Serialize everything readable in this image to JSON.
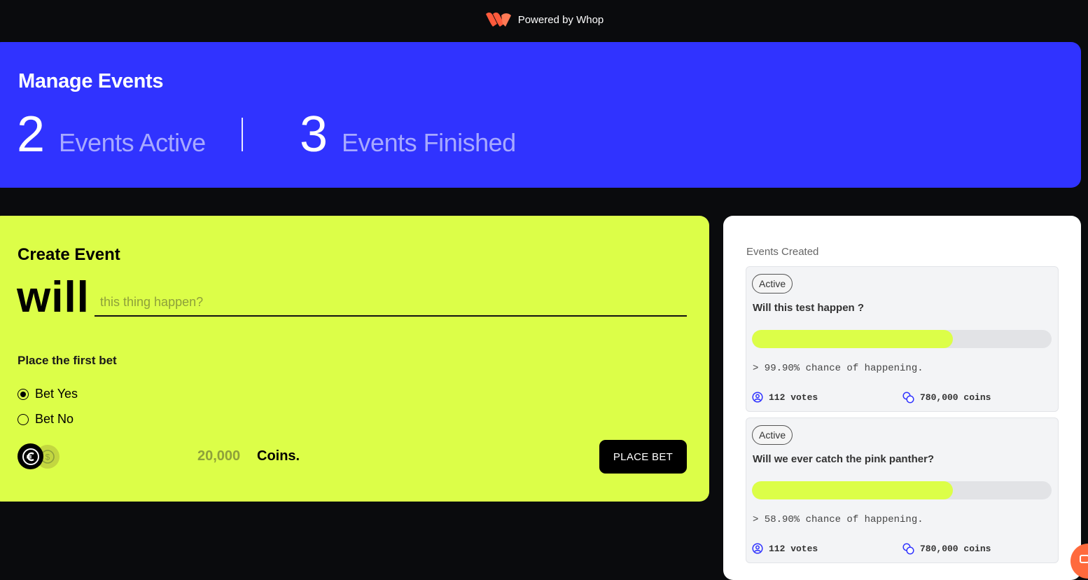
{
  "topbar": {
    "powered_by": "Powered by Whop",
    "logo_color": "#ff5a3c"
  },
  "hero": {
    "title": "Manage Events",
    "active_count": "2",
    "active_label": "Events Active",
    "finished_count": "3",
    "finished_label": "Events Finished",
    "bg_color": "#3033ff"
  },
  "create": {
    "title": "Create Event",
    "prefix": "will",
    "question_placeholder": "this thing happen?",
    "question_value": "",
    "first_bet_label": "Place the first bet",
    "options": [
      {
        "label": "Bet Yes",
        "selected": true
      },
      {
        "label": "Bet No",
        "selected": false
      }
    ],
    "amount": "20,000",
    "amount_unit": "Coins.",
    "place_bet_label": "PLACE BET",
    "bg_color": "#dcfe48"
  },
  "events": {
    "title": "Events Created",
    "items": [
      {
        "status": "Active",
        "question": "Will this test happen ?",
        "chance_text": "> 99.90% chance of happening.",
        "progress": 0.67,
        "votes": "112 votes",
        "coins": "780,000 coins"
      },
      {
        "status": "Active",
        "question": "Will we ever catch the pink panther?",
        "chance_text": "> 58.90% chance of happening.",
        "progress": 0.67,
        "votes": "112 votes",
        "coins": "780,000 coins"
      }
    ]
  }
}
